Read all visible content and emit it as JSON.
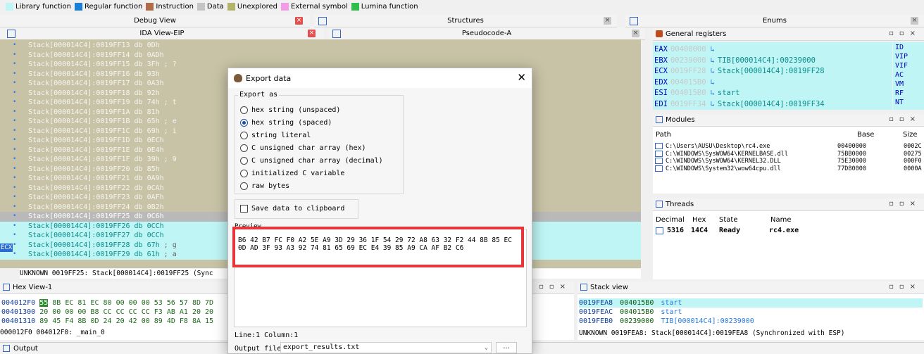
{
  "legend": [
    {
      "label": "Library function",
      "color": "#bff5f5"
    },
    {
      "label": "Regular function",
      "color": "#1a7fd6"
    },
    {
      "label": "Instruction",
      "color": "#b06c4a"
    },
    {
      "label": "Data",
      "color": "#c4c4c4"
    },
    {
      "label": "Unexplored",
      "color": "#b3b36a"
    },
    {
      "label": "External symbol",
      "color": "#f29ce8"
    },
    {
      "label": "Lumina function",
      "color": "#2fbf4a"
    }
  ],
  "tabs": {
    "debug_view": "Debug View",
    "structures": "Structures",
    "enums": "Enums",
    "ida_view": "IDA View-EIP",
    "pseudocode": "Pseudocode-A"
  },
  "listing": [
    {
      "text": "Stack[000014C4]:0019FF13 db  0Dh",
      "cmt": "",
      "style": "stack-ctx"
    },
    {
      "text": "Stack[000014C4]:0019FF14 db  0ADh",
      "cmt": "",
      "style": "stack-ctx"
    },
    {
      "text": "Stack[000014C4]:0019FF15 db  3Fh",
      "cmt": " ; ?",
      "style": "stack-ctx"
    },
    {
      "text": "Stack[000014C4]:0019FF16 db  93h",
      "cmt": "",
      "style": "stack-ctx"
    },
    {
      "text": "Stack[000014C4]:0019FF17 db  0A3h",
      "cmt": "",
      "style": "stack-ctx"
    },
    {
      "text": "Stack[000014C4]:0019FF18 db  92h",
      "cmt": "",
      "style": "stack-ctx"
    },
    {
      "text": "Stack[000014C4]:0019FF19 db  74h",
      "cmt": " ; t",
      "style": "stack-ctx"
    },
    {
      "text": "Stack[000014C4]:0019FF1A db  81h",
      "cmt": "",
      "style": "stack-ctx"
    },
    {
      "text": "Stack[000014C4]:0019FF1B db  65h",
      "cmt": " ; e",
      "style": "stack-ctx"
    },
    {
      "text": "Stack[000014C4]:0019FF1C db  69h",
      "cmt": " ; i",
      "style": "stack-ctx"
    },
    {
      "text": "Stack[000014C4]:0019FF1D db  0ECh",
      "cmt": "",
      "style": "stack-ctx"
    },
    {
      "text": "Stack[000014C4]:0019FF1E db  0E4h",
      "cmt": "",
      "style": "stack-ctx"
    },
    {
      "text": "Stack[000014C4]:0019FF1F db  39h",
      "cmt": " ; 9",
      "style": "stack-ctx"
    },
    {
      "text": "Stack[000014C4]:0019FF20 db  85h",
      "cmt": "",
      "style": "stack-ctx"
    },
    {
      "text": "Stack[000014C4]:0019FF21 db  0A9h",
      "cmt": "",
      "style": "stack-ctx"
    },
    {
      "text": "Stack[000014C4]:0019FF22 db  0CAh",
      "cmt": "",
      "style": "stack-ctx"
    },
    {
      "text": "Stack[000014C4]:0019FF23 db  0AFh",
      "cmt": "",
      "style": "stack-ctx"
    },
    {
      "text": "Stack[000014C4]:0019FF24 db  0B2h",
      "cmt": "",
      "style": "stack-ctx"
    },
    {
      "text": "Stack[000014C4]:0019FF25 db  0C6h",
      "cmt": "",
      "style": "sel"
    },
    {
      "text": "Stack[000014C4]:0019FF26 db  0CCh",
      "cmt": "",
      "style": "cyan"
    },
    {
      "text": "Stack[000014C4]:0019FF27 db  0CCh",
      "cmt": "",
      "style": "cyan"
    },
    {
      "text": "Stack[000014C4]:0019FF28 db  67h",
      "cmt": " ; g",
      "style": "cyan"
    },
    {
      "text": "Stack[000014C4]:0019FF29 db  61h",
      "cmt": " ; a",
      "style": "cyan"
    }
  ],
  "ecx_tag": "ECX",
  "ida_status": "UNKNOWN 0019FF25: Stack[000014C4]:0019FF25 (Sync",
  "registers": {
    "title": "General registers",
    "rows": [
      {
        "name": "EAX",
        "value": "00400000",
        "deref": ""
      },
      {
        "name": "EBX",
        "value": "00239000",
        "deref": "TIB[000014C4]:00239000"
      },
      {
        "name": "ECX",
        "value": "0019FF28",
        "deref": "Stack[000014C4]:0019FF28"
      },
      {
        "name": "EDX",
        "value": "004015B0",
        "deref": ""
      },
      {
        "name": "ESI",
        "value": "004015B0",
        "deref": "start"
      },
      {
        "name": "EDI",
        "value": "0019FF34",
        "deref": "Stack[000014C4]:0019FF34"
      }
    ],
    "flags": [
      "ID",
      "VIP",
      "VIF",
      "AC",
      "VM",
      "RF",
      "NT"
    ]
  },
  "modules": {
    "title": "Modules",
    "headers": [
      "Path",
      "Base",
      "Size"
    ],
    "rows": [
      {
        "path": "C:\\Users\\AUSU\\Desktop\\rc4.exe",
        "base": "00400000",
        "size": "0002C"
      },
      {
        "path": "C:\\WINDOWS\\SysWOW64\\KERNELBASE.dll",
        "base": "75BB0000",
        "size": "00275"
      },
      {
        "path": "C:\\WINDOWS\\SysWOW64\\KERNEL32.DLL",
        "base": "75E30000",
        "size": "000F0"
      },
      {
        "path": "C:\\WINDOWS\\System32\\wow64cpu.dll",
        "base": "77D80000",
        "size": "0000A"
      }
    ]
  },
  "threads": {
    "title": "Threads",
    "headers": [
      "Decimal",
      "Hex",
      "State",
      "Name"
    ],
    "row": {
      "decimal": "5316",
      "hex": "14C4",
      "state": "Ready",
      "name": "rc4.exe"
    }
  },
  "hexview": {
    "title": "Hex View-1",
    "rows": [
      {
        "addr": "004012F0",
        "first": "55",
        "bytes": " 8B EC 81 EC 80 00 00  00 53 56 57 8D 7D"
      },
      {
        "addr": "00401300",
        "first": "",
        "bytes": "20 00 00 00 B8 CC CC CC  CC F3 AB A1 20 20"
      },
      {
        "addr": "00401310",
        "first": "",
        "bytes": "89 45 F4 8B 0D 24 20 42  00 89 4D F8 8A 15"
      }
    ],
    "status": "000012F0 004012F0: _main_0"
  },
  "stackview": {
    "title": "Stack view",
    "rows": [
      {
        "addr": "0019FEA8",
        "val": "004015B0",
        "sym": "start"
      },
      {
        "addr": "0019FEAC",
        "val": "004015B0",
        "sym": "start"
      },
      {
        "addr": "0019FEB0",
        "val": "00239000",
        "sym": "TIB[000014C4]:00239000"
      }
    ],
    "status": "UNKNOWN 0019FEA8: Stack[000014C4]:0019FEA8 (Synchronized with ESP)"
  },
  "output_label": "Output",
  "dialog": {
    "title": "Export data",
    "export_as_label": "Export as",
    "options": [
      {
        "label": "hex string (unspaced)",
        "selected": false
      },
      {
        "label": "hex string (spaced)",
        "selected": true
      },
      {
        "label": "string literal",
        "selected": false
      },
      {
        "label": "C unsigned char array (hex)",
        "selected": false
      },
      {
        "label": "C unsigned char array (decimal)",
        "selected": false
      },
      {
        "label": "initialized C variable",
        "selected": false
      },
      {
        "label": "raw bytes",
        "selected": false
      }
    ],
    "clipboard_label": "Save data to clipboard",
    "preview_label": "Preview",
    "preview_text": "B6 42 B7 FC F0 A2 5E A9 3D 29 36 1F 54 29 72 A8 63 32 F2 44 8B 85 EC 0D AD 3F 93 A3 92 74 81 65 69 EC E4 39 85 A9 CA AF B2 C6",
    "position": "Line:1  Column:1",
    "output_file_label": "Output file",
    "output_file_value": "export_results.txt",
    "browse_label": "..."
  }
}
